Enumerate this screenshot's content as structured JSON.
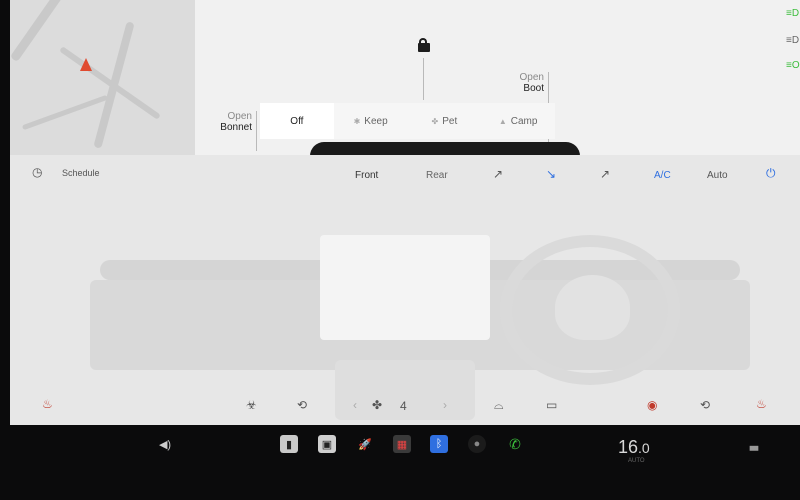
{
  "top": {
    "open_bonnet": {
      "top": "Open",
      "bottom": "Bonnet"
    },
    "open_boot": {
      "top": "Open",
      "bottom": "Boot"
    },
    "modes": [
      "Off",
      "Keep",
      "Pet",
      "Camp"
    ],
    "selected_mode": "Off"
  },
  "climate": {
    "schedule": "Schedule",
    "front": "Front",
    "rear": "Rear",
    "ac": "A/C",
    "auto": "Auto",
    "fan_level": "4"
  },
  "taskbar": {
    "temperature": "16",
    "temperature_decimal": ".0",
    "temperature_sub": "AUTO"
  },
  "colors": {
    "accent_blue": "#2f6fe0",
    "indicator_green": "#3cbd3c",
    "pin_orange": "#e04a2f"
  }
}
